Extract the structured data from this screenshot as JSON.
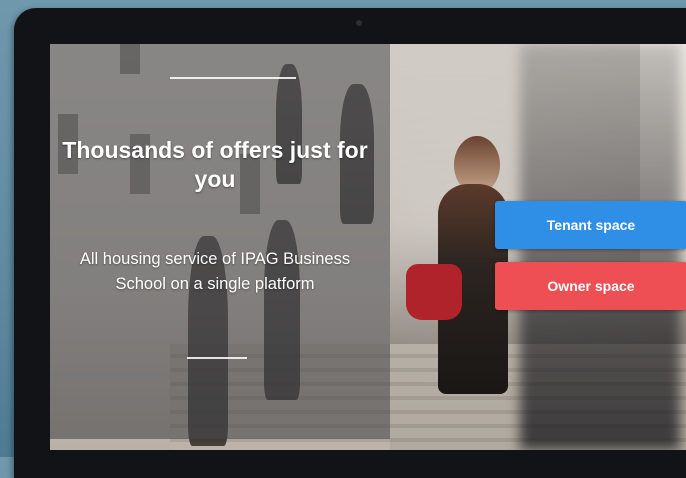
{
  "hero": {
    "headline": "Thousands of offers just for you",
    "subline": "All housing service of IPAG Business School on a single platform"
  },
  "actions": {
    "tenant_label": "Tenant space",
    "owner_label": "Owner space"
  },
  "colors": {
    "tenant_button": "#2f8fe6",
    "owner_button": "#ee4f55",
    "bezel": "#111316"
  }
}
